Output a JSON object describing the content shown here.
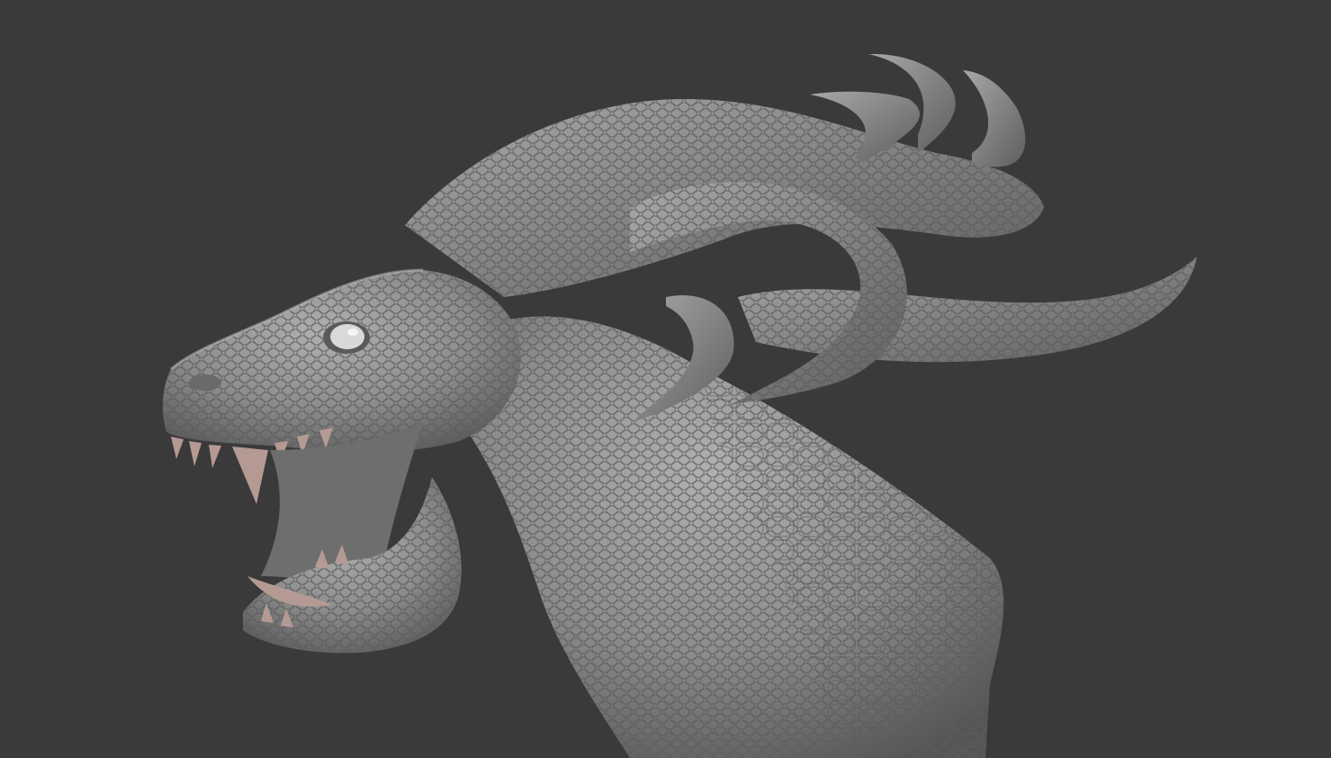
{
  "scene": {
    "subject_icon": "dragon-bust-sculpt-icon",
    "colors": {
      "background": "#3a3a3a",
      "clay": "#8a8a8a",
      "clay_light": "#a9a9a9",
      "clay_dark": "#5b5b5b",
      "teeth": "#b59a94",
      "eye": "#e0e0e0"
    }
  }
}
